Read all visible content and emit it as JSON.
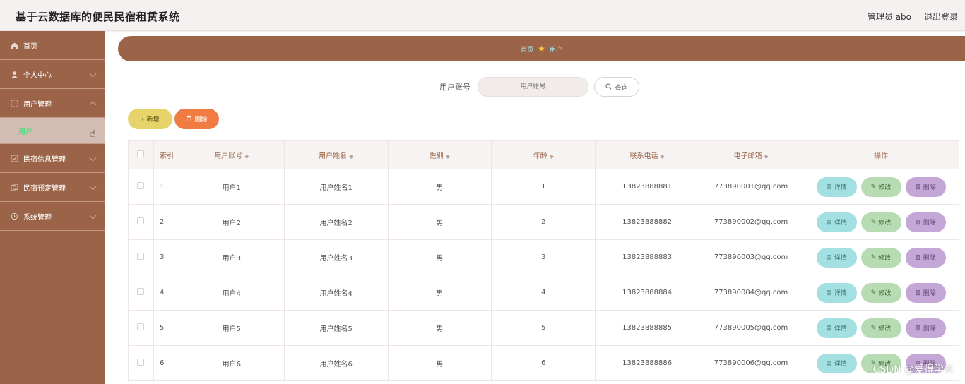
{
  "header": {
    "title": "基于云数据库的便民民宿租赁系统",
    "user_label": "管理员 abo",
    "logout_label": "退出登录"
  },
  "sidebar": {
    "items": [
      {
        "label": "首页",
        "icon": "home-icon"
      },
      {
        "label": "个人中心",
        "icon": "user-icon"
      },
      {
        "label": "用户管理",
        "icon": "users-icon"
      },
      {
        "label": "民宿信息管理",
        "icon": "info-icon"
      },
      {
        "label": "民宿预定管理",
        "icon": "copy-icon"
      },
      {
        "label": "系统管理",
        "icon": "settings-icon"
      }
    ],
    "sub_active": "用户"
  },
  "breadcrumb": {
    "home": "首页",
    "current": "用户"
  },
  "search": {
    "label": "用户账号",
    "placeholder": "用户账号",
    "button": "查询"
  },
  "actions": {
    "add": "新增",
    "delete": "删除"
  },
  "table": {
    "headers": [
      "索引",
      "用户账号",
      "用户姓名",
      "性别",
      "年龄",
      "联系电话",
      "电子邮箱",
      "操作"
    ],
    "row_actions": {
      "detail": "详情",
      "edit": "修改",
      "remove": "删除"
    },
    "rows": [
      {
        "index": "1",
        "account": "用户1",
        "name": "用户姓名1",
        "sex": "男",
        "age": "1",
        "phone": "13823888881",
        "email": "773890001@qq.com"
      },
      {
        "index": "2",
        "account": "用户2",
        "name": "用户姓名2",
        "sex": "男",
        "age": "2",
        "phone": "13823888882",
        "email": "773890002@qq.com"
      },
      {
        "index": "3",
        "account": "用户3",
        "name": "用户姓名3",
        "sex": "男",
        "age": "3",
        "phone": "13823888883",
        "email": "773890003@qq.com"
      },
      {
        "index": "4",
        "account": "用户4",
        "name": "用户姓名4",
        "sex": "男",
        "age": "4",
        "phone": "13823888884",
        "email": "773890004@qq.com"
      },
      {
        "index": "5",
        "account": "用户5",
        "name": "用户姓名5",
        "sex": "男",
        "age": "5",
        "phone": "13823888885",
        "email": "773890005@qq.com"
      },
      {
        "index": "6",
        "account": "用户6",
        "name": "用户姓名6",
        "sex": "男",
        "age": "6",
        "phone": "13823888886",
        "email": "773890006@qq.com"
      }
    ]
  },
  "watermark": "CSDN @爱得学长",
  "colors": {
    "brand": "#9b6448",
    "active_sub": "#3ee07a",
    "add_button": "#e6d46a",
    "delete_button": "#f07c44",
    "detail_button": "#a2e0e2",
    "edit_button": "#b7dcb4",
    "remove_button": "#c4a7d6"
  }
}
